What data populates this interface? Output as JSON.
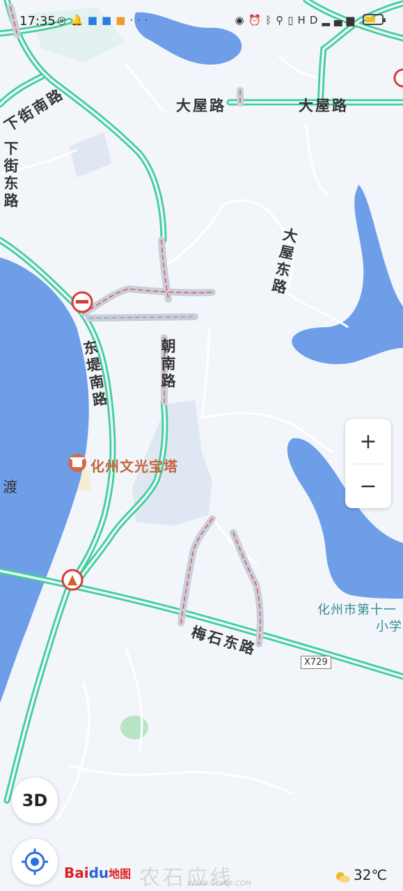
{
  "status_bar": {
    "time": "17:35",
    "left_icons": [
      "wechat-icon",
      "bell-icon",
      "app-icon",
      "app-icon",
      "app-icon",
      "more-icon"
    ],
    "more": "···",
    "right_icons": [
      "eye-icon",
      "alarm-icon",
      "bluetooth-icon",
      "location-icon",
      "vibrate-icon",
      "hd-icon",
      "signal-icon"
    ],
    "hd": "HD",
    "battery_level": 0.55,
    "battery_color": "#f3c21a"
  },
  "map": {
    "road_color": "#3ecf9a",
    "water_color": "#6f9ee8",
    "closed_road_color": "#c8cfdb",
    "road_labels": {
      "dawu_lu_1": "大屋路",
      "dawu_lu_2": "大屋路",
      "xiajie_nan_lu": "下街南路",
      "xiajie_dong_lu": "下街东路",
      "dawu_dong_lu": "大屋东路",
      "dongdi_nan_lu": "东堤南路",
      "chaonan_lu": "朝南路",
      "meishi_dong_lu": "梅石东路",
      "du": "渡"
    },
    "highway_badge": "X729",
    "poi": {
      "pagoda": "化州文光宝塔",
      "school_line1": "化州市第十一",
      "school_line2": "小学"
    }
  },
  "controls": {
    "zoom_in": "+",
    "zoom_out": "−",
    "btn_3d": "3D"
  },
  "footer": {
    "logo_bai": "Bai",
    "logo_du": "du",
    "logo_ditu": "地图",
    "watermark": "农石应线",
    "watermark_url": "WWW.GDMM.COM",
    "temperature": "32℃"
  }
}
